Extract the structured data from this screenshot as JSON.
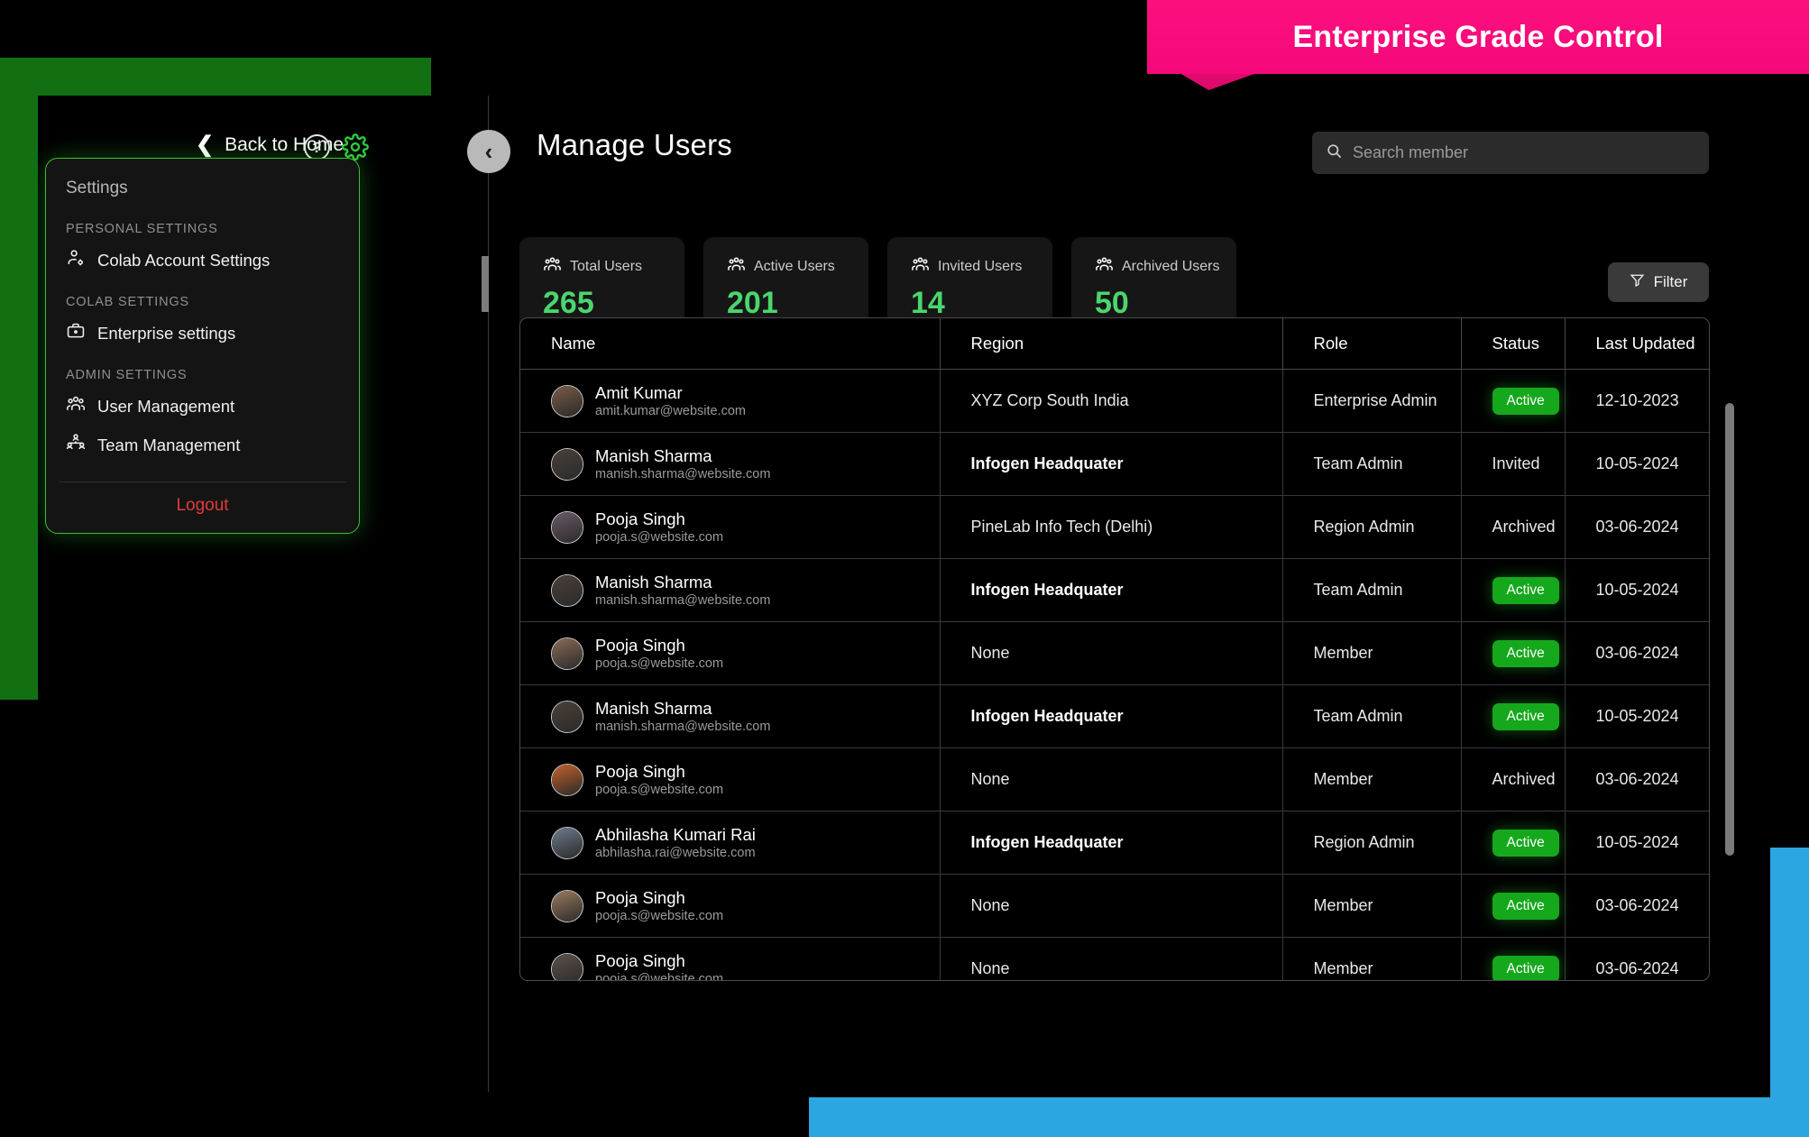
{
  "banner": {
    "text": "Enterprise Grade Control",
    "color": "#fc0f7d"
  },
  "accent": {
    "green": "#3fbe2e",
    "value_green": "#4ad66d",
    "badge_green": "#15a81c",
    "logout_red": "#e23b3b",
    "blue": "#2ba6e0"
  },
  "left_panel": {
    "back_to_home": "Back to Home",
    "help_glyph": "?",
    "menu": {
      "title": "Settings",
      "groups": [
        {
          "label": "PERSONAL SETTINGS",
          "items": [
            {
              "label": "Colab Account Settings",
              "icon": "user-settings-icon"
            }
          ]
        },
        {
          "label": "COLAB SETTINGS",
          "items": [
            {
              "label": "Enterprise settings",
              "icon": "briefcase-icon"
            }
          ]
        },
        {
          "label": "ADMIN SETTINGS",
          "items": [
            {
              "label": "User Management",
              "icon": "users-group-icon"
            },
            {
              "label": "Team Management",
              "icon": "team-hierarchy-icon"
            }
          ]
        }
      ],
      "logout": "Logout"
    }
  },
  "main": {
    "back_glyph": "‹",
    "title": "Manage Users",
    "search": {
      "placeholder": "Search member",
      "value": "",
      "icon": "search-icon"
    },
    "filter_button": {
      "label": "Filter",
      "icon": "funnel-icon"
    },
    "stats": [
      {
        "label": "Total Users",
        "value": "265",
        "icon": "users-group-icon"
      },
      {
        "label": "Active Users",
        "value": "201",
        "icon": "users-group-icon"
      },
      {
        "label": "Invited Users",
        "value": "14",
        "icon": "users-group-icon"
      },
      {
        "label": "Archived Users",
        "value": "50",
        "icon": "users-group-icon"
      }
    ],
    "table": {
      "columns": [
        "Name",
        "Region",
        "Role",
        "Status",
        "Last Updated"
      ],
      "rows": [
        {
          "name": "Amit Kumar",
          "email": "amit.kumar@website.com",
          "region": "XYZ Corp South India",
          "region_bold": false,
          "role": "Enterprise Admin",
          "status": "Active",
          "updated": "12-10-2023",
          "avatar": "#7a5c46"
        },
        {
          "name": "Manish Sharma",
          "email": "manish.sharma@website.com",
          "region": "Infogen Headquater",
          "region_bold": true,
          "role": "Team Admin",
          "status": "Invited",
          "updated": "10-05-2024",
          "avatar": "#4a4038"
        },
        {
          "name": "Pooja Singh",
          "email": "pooja.s@website.com",
          "region": "PineLab Info Tech (Delhi)",
          "region_bold": false,
          "role": "Region Admin",
          "status": "Archived",
          "updated": "03-06-2024",
          "avatar": "#6b5a66"
        },
        {
          "name": "Manish Sharma",
          "email": "manish.sharma@website.com",
          "region": "Infogen Headquater",
          "region_bold": true,
          "role": "Team Admin",
          "status": "Active",
          "updated": "10-05-2024",
          "avatar": "#4a4038"
        },
        {
          "name": "Pooja Singh",
          "email": "pooja.s@website.com",
          "region": "None",
          "region_bold": false,
          "role": "Member",
          "status": "Active",
          "updated": "03-06-2024",
          "avatar": "#8a6a58"
        },
        {
          "name": "Manish Sharma",
          "email": "manish.sharma@website.com",
          "region": "Infogen Headquater",
          "region_bold": true,
          "role": "Team Admin",
          "status": "Active",
          "updated": "10-05-2024",
          "avatar": "#4a4038"
        },
        {
          "name": "Pooja Singh",
          "email": "pooja.s@website.com",
          "region": "None",
          "region_bold": false,
          "role": "Member",
          "status": "Archived",
          "updated": "03-06-2024",
          "avatar": "#c4622a"
        },
        {
          "name": "Abhilasha Kumari Rai",
          "email": "abhilasha.rai@website.com",
          "region": "Infogen Headquater",
          "region_bold": true,
          "role": "Region Admin",
          "status": "Active",
          "updated": "10-05-2024",
          "avatar": "#6d7a8c"
        },
        {
          "name": "Pooja Singh",
          "email": "pooja.s@website.com",
          "region": "None",
          "region_bold": false,
          "role": "Member",
          "status": "Active",
          "updated": "03-06-2024",
          "avatar": "#9a7b5e"
        },
        {
          "name": "Pooja Singh",
          "email": "pooja.s@website.com",
          "region": "None",
          "region_bold": false,
          "role": "Member",
          "status": "Active",
          "updated": "03-06-2024",
          "avatar": "#5c5148"
        }
      ]
    }
  }
}
